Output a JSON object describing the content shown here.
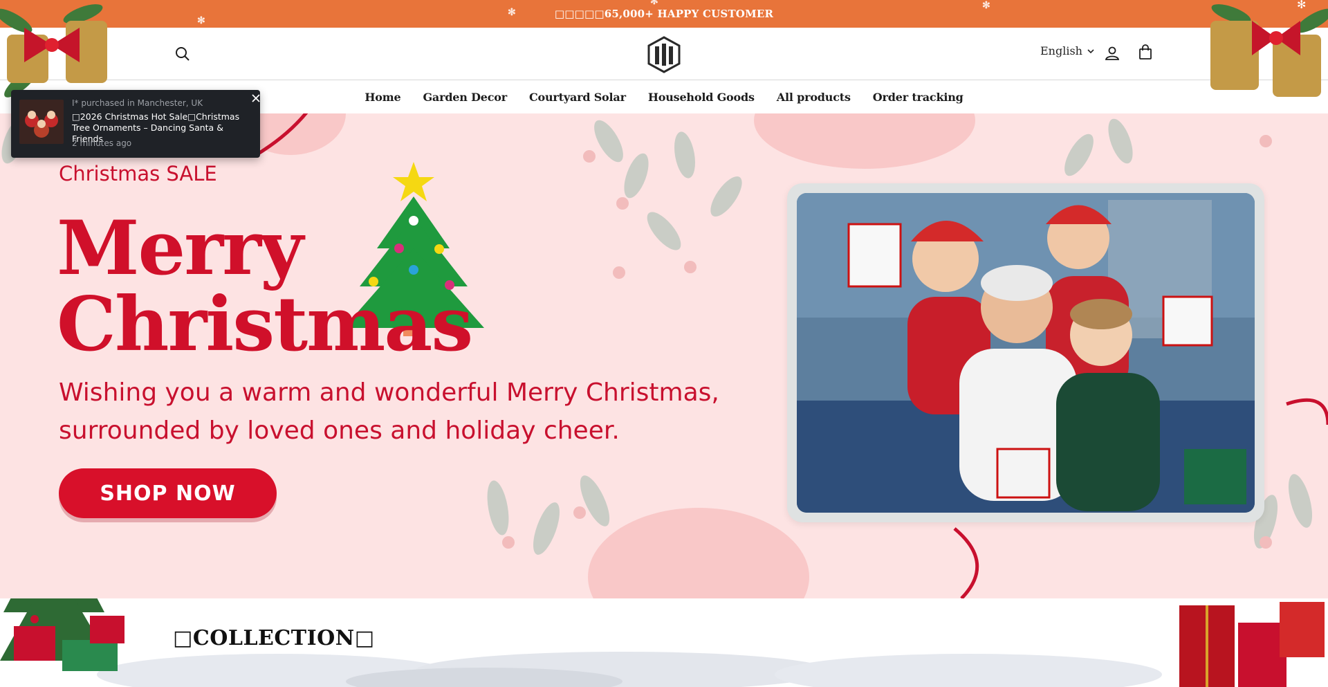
{
  "announcement": {
    "text": "□□□□□65,000+ HAPPY CUSTOMER"
  },
  "header": {
    "language": "English",
    "icons": [
      "search-icon",
      "logo-mark",
      "user-icon",
      "shopping-bag-icon",
      "chevron-down-icon"
    ]
  },
  "nav": {
    "items": [
      {
        "label": "Home"
      },
      {
        "label": "Garden Decor"
      },
      {
        "label": "Courtyard Solar"
      },
      {
        "label": "Household Goods"
      },
      {
        "label": "All products"
      },
      {
        "label": "Order tracking"
      }
    ]
  },
  "toast": {
    "who": "I* purchased in Manchester, UK",
    "product": "□2026 Christmas Hot Sale□Christmas Tree Ornaments – Dancing Santa & Friends",
    "time": "2 minutes ago"
  },
  "hero": {
    "sale_label": "Christmas SALE",
    "title_line1": "Merry",
    "title_line2": "Christmas",
    "subtitle": "Wishing you a warm and wonderful Merry Christmas, surrounded by loved ones and holiday cheer.",
    "cta": "SHOP NOW"
  },
  "collection": {
    "title": "□COLLECTION□"
  },
  "colors": {
    "announcement_bg": "#e8743a",
    "hero_bg": "#fde3e3",
    "brand_red": "#d0102a",
    "toast_bg": "#1f2227"
  }
}
